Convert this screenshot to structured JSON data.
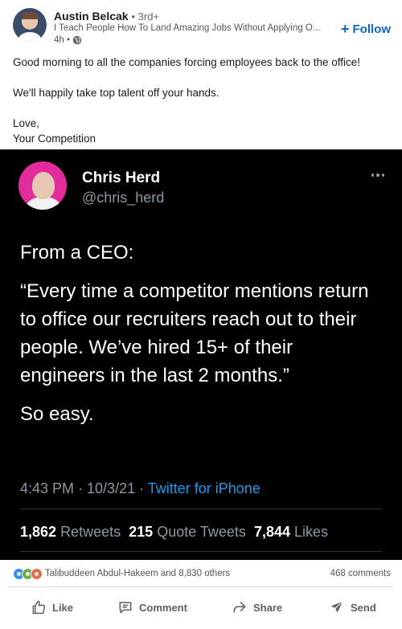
{
  "post": {
    "author": {
      "name": "Austin Belcak",
      "degree": "• 3rd+",
      "headline": "I Teach People How To Land Amazing Jobs Without Applying O...",
      "time": "4h •"
    },
    "follow_label": "Follow",
    "text": {
      "line1": "Good morning to all the companies forcing employees back to the office!",
      "line2": "We'll happily take top talent off your hands.",
      "line3": "Love,",
      "line4": "Your Competition"
    }
  },
  "tweet": {
    "name": "Chris Herd",
    "handle": "@chris_herd",
    "body": [
      "From a CEO:",
      "“Every time a competitor mentions return to office our recruiters reach out to their people. We’ve hired 15+ of their engineers in the last 2 months.”",
      "So easy."
    ],
    "timestamp": "4:43 PM · 10/3/21 · ",
    "source": "Twitter for iPhone",
    "stats": {
      "retweets_count": "1,862",
      "retweets_label": "Retweets",
      "quotes_count": "215",
      "quotes_label": "Quote Tweets",
      "likes_count": "7,844",
      "likes_label": "Likes"
    }
  },
  "social": {
    "reactors": "Talibuddeen Abdul-Hakeem and 8,830 others",
    "comments": "468 comments"
  },
  "actions": {
    "like": "Like",
    "comment": "Comment",
    "share": "Share",
    "send": "Send"
  },
  "colors": {
    "linkedin_blue": "#0a66c2",
    "twitter_blue": "#1d9bf0",
    "tweet_bg": "#000000",
    "avatar_pink": "#e32c9c"
  }
}
